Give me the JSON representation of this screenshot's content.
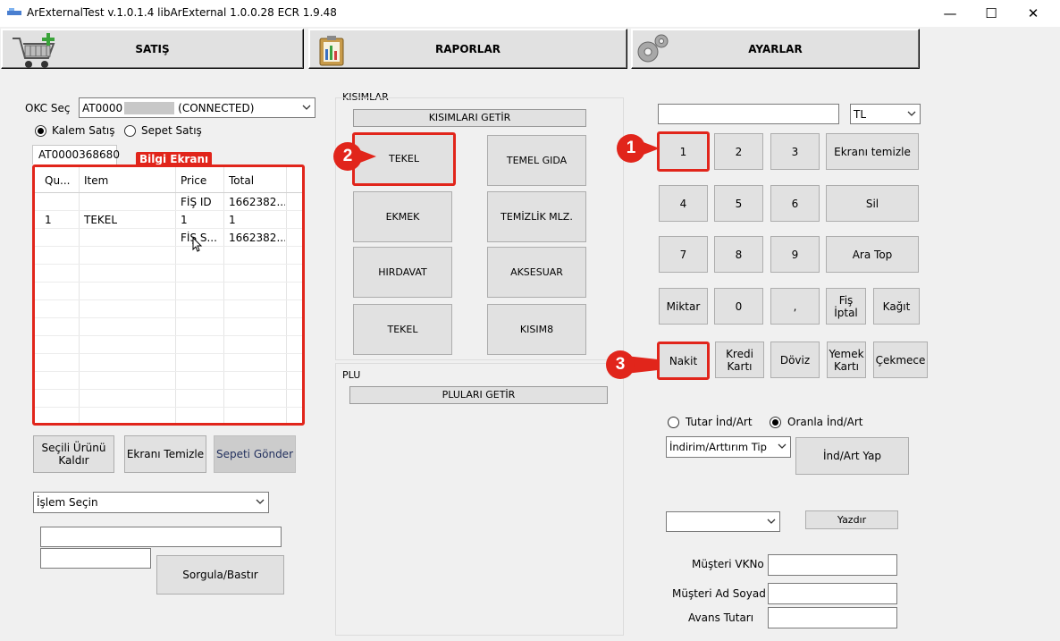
{
  "window": {
    "title": "ArExternalTest v.1.0.1.4 libArExternal 1.0.0.28 ECR 1.9.48",
    "minimize": "—",
    "maximize": "☐",
    "close": "✕"
  },
  "tabs": {
    "satis": "SATIŞ",
    "raporlar": "RAPORLAR",
    "ayarlar": "AYARLAR"
  },
  "left": {
    "okc_label": "OKC Seç",
    "okc_value_prefix": "AT0000",
    "okc_value_suffix": "(CONNECTED)",
    "radio_kalem": "Kalem Satış",
    "radio_sepet": "Sepet Satış",
    "device_tab": "AT0000368680",
    "bilgi_label": "Bilgi Ekranı",
    "grid_headers": [
      "Qu...",
      "Item",
      "Price",
      "Total"
    ],
    "grid_rows": [
      [
        "",
        "",
        "FİŞ ID",
        "1662382..."
      ],
      [
        "1",
        "TEKEL",
        "1",
        "1"
      ],
      [
        "",
        "",
        "FİŞ S...",
        "1662382..."
      ]
    ],
    "btn_kaldir": "Seçili Ürünü Kaldır",
    "btn_temizle": "Ekranı Temizle",
    "btn_gonder": "Sepeti Gönder",
    "islem_combo": "İşlem Seçin",
    "btn_sorgula": "Sorgula/Bastır"
  },
  "kisimlar": {
    "group_label": "KISIMLAR",
    "getir": "KISIMLARI GETİR",
    "buttons": [
      "TEKEL",
      "TEMEL GIDA",
      "EKMEK",
      "TEMİZLİK MLZ.",
      "HIRDAVAT",
      "AKSESUAR",
      "TEKEL",
      "KISIM8"
    ]
  },
  "plu": {
    "group_label": "PLU",
    "getir": "PLULARI GETİR"
  },
  "right": {
    "currency": "TL",
    "keys": [
      "1",
      "2",
      "3",
      "Ekranı temizle",
      "4",
      "5",
      "6",
      "Sil",
      "7",
      "8",
      "9",
      "Ara Top"
    ],
    "miktar": "Miktar",
    "zero": "0",
    "comma": ",",
    "fis_iptal": "Fiş İptal",
    "kagit": "Kağıt",
    "nakit": "Nakit",
    "kredi": "Kredi Kartı",
    "doviz": "Döviz",
    "yemek": "Yemek Kartı",
    "cekmece": "Çekmece",
    "radio_tutar": "Tutar İnd/Art",
    "radio_oran": "Oranla İnd/Art",
    "ind_combo": "İndirim/Arttırım Tip",
    "ind_yap": "İnd/Art Yap",
    "yazdir": "Yazdır",
    "vkno": "Müşteri VKNo",
    "adsoyad": "Müşteri Ad Soyad",
    "avans": "Avans Tutarı"
  },
  "badges": [
    "1",
    "2",
    "3"
  ]
}
